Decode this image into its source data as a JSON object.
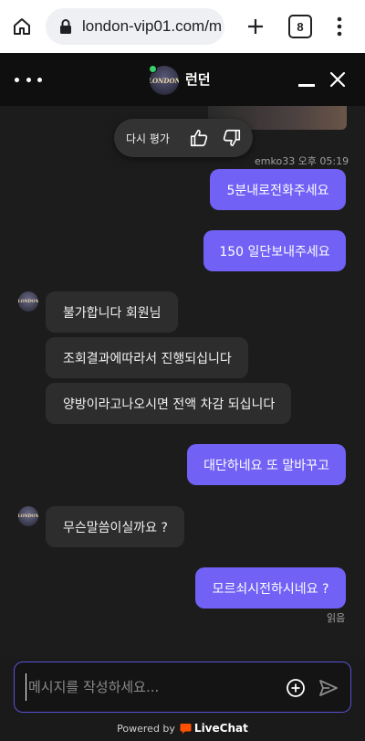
{
  "browser": {
    "url": "london-vip01.com/m",
    "tab_count": "8"
  },
  "header": {
    "title": "런던",
    "logo_text": "LONDON"
  },
  "rating": {
    "label": "다시 평가"
  },
  "messages": [
    {
      "author": "emko33",
      "time": "오후 05:19",
      "meta": "emko33 오후 05:19"
    },
    {
      "text": "5분내로전화주세요",
      "side": "out"
    },
    {
      "text": "150 일단보내주세요",
      "side": "out"
    },
    {
      "text": "불가합니다 회원님",
      "side": "in"
    },
    {
      "text": "조회결과에따라서 진행되십니다",
      "side": "in"
    },
    {
      "text": "양방이라고나오시면 전액 차감 되십니다",
      "side": "in"
    },
    {
      "text": "대단하네요 또 말바꾸고",
      "side": "out"
    },
    {
      "text": "무슨말씀이실까요 ?",
      "side": "in"
    },
    {
      "text": "모르쇠시전하시네요 ?",
      "side": "out"
    },
    {
      "text": "읽음",
      "side": "status"
    }
  ],
  "composer": {
    "placeholder": "메시지를 작성하세요..."
  },
  "footer": {
    "powered_by": "Powered by",
    "brand": "LiveChat"
  },
  "colors": {
    "outgoing_bubble": "#7161f5",
    "incoming_bubble": "#2d2d2d",
    "background": "#1c1c1c",
    "header": "#0f0f0f",
    "online": "#39d26a",
    "livechat_brand": "#ff5100"
  }
}
